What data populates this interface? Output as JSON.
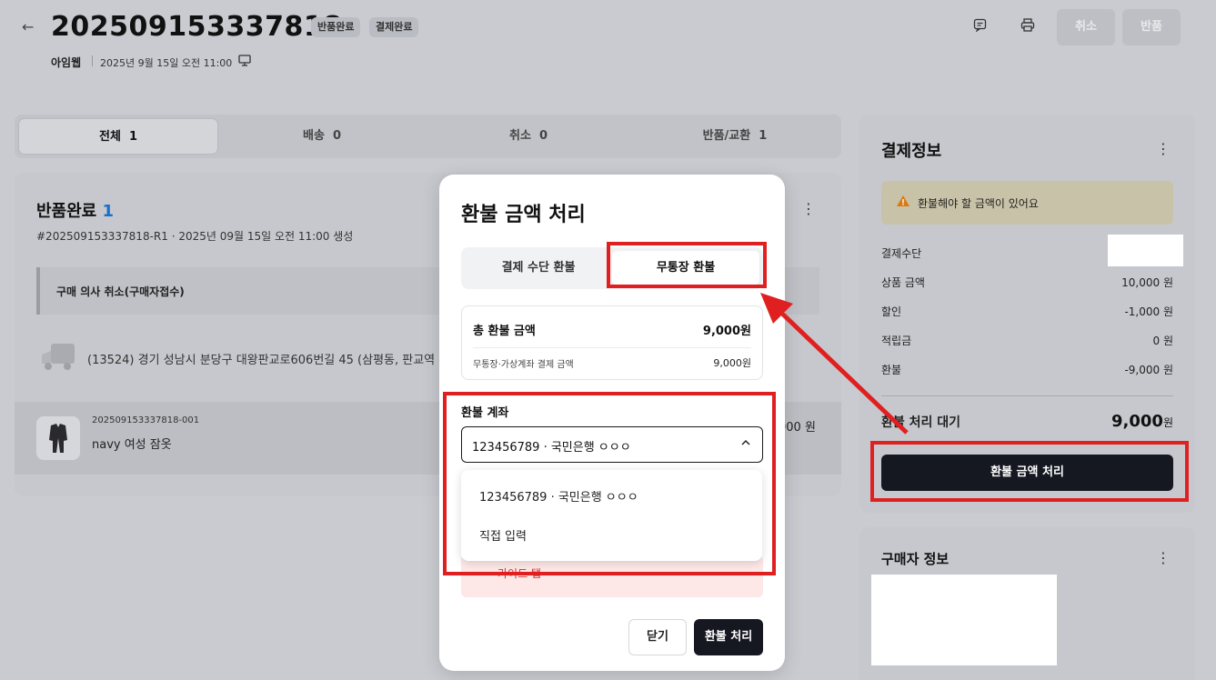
{
  "header": {
    "order_no": "202509153337818",
    "badges": [
      "반품완료",
      "결제완료"
    ],
    "shop": "아임웹",
    "order_date": "2025년 9월 15일 오전 11:00",
    "actions": {
      "cancel": "취소",
      "return": "반품"
    }
  },
  "tabs": [
    {
      "label": "전체",
      "count": "1"
    },
    {
      "label": "배송",
      "count": "0"
    },
    {
      "label": "취소",
      "count": "0"
    },
    {
      "label": "반품/교환",
      "count": "1"
    }
  ],
  "return_card": {
    "title": "반품완료",
    "count": "1",
    "subtitle": "#202509153337818-R1 · 2025년 09월 15일 오전 11:00 생성",
    "reason": "구매 의사 취소(구매자접수)",
    "address": "(13524) 경기 성남시 분당구 대왕판교로606번길 45 (삼평동, 판교역 푸",
    "item": {
      "code": "202509153337818-001",
      "name": "navy 여성 잠옷",
      "price": "000 원"
    }
  },
  "payment": {
    "title": "결제정보",
    "notice": "환불해야 할 금액이 있어요",
    "rows": [
      {
        "label": "결제수단",
        "value": ""
      },
      {
        "label": "상품 금액",
        "value": "10,000 원"
      },
      {
        "label": "할인",
        "value": "-1,000 원"
      },
      {
        "label": "적립금",
        "value": "0 원"
      },
      {
        "label": "환불",
        "value": "-9,000 원"
      }
    ],
    "pending_label": "환불 처리 대기",
    "pending_amount": "9,000",
    "pending_unit": "원",
    "button": "환불 금액 처리"
  },
  "buyer": {
    "title": "구매자 정보"
  },
  "modal": {
    "title": "환불 금액 처리",
    "tabs": [
      "결제 수단 환불",
      "무통장 환불"
    ],
    "active_tab": "무통장 환불",
    "total_label": "총 환불 금액",
    "total_value": "9,000원",
    "sub_label": "무통장·가상계좌 결제 금액",
    "sub_value": "9,000원",
    "account_label": "환불 계좌",
    "account_selected": "123456789 · 국민은행 ㅇㅇㅇ",
    "options": [
      "123456789 · 국민은행 ㅇㅇㅇ",
      "직접 입력"
    ],
    "guide_text": "가이드 탭",
    "close_label": "닫기",
    "submit_label": "환불 처리"
  },
  "colors": {
    "annotation": "#e02020",
    "primary_button": "#151821",
    "badge_blue": "#1a6fcc"
  }
}
